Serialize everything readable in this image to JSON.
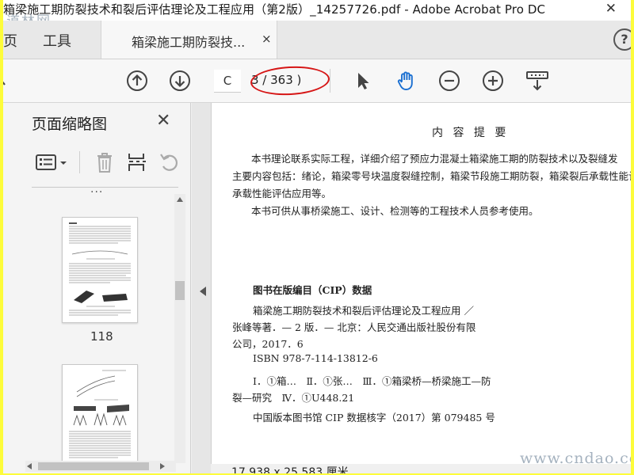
{
  "window": {
    "title": "箱梁施工期防裂技术和裂后评估理论及工程应用（第2版）_14257726.pdf - Adobe Acrobat Pro DC",
    "close_glyph": "✕",
    "watermark_top": "道林网"
  },
  "tabs": {
    "home": "页",
    "tools": "工具",
    "document": "箱梁施工期防裂技...",
    "close_glyph": "×",
    "help": "?"
  },
  "toolbar": {
    "page_input": "C",
    "page_count": "3 / 363 )",
    "icons": [
      "prev-page-icon",
      "next-page-icon",
      "select-arrow-icon",
      "hand-tool-icon",
      "zoom-out-icon",
      "zoom-in-icon",
      "scroll-mode-icon"
    ]
  },
  "panel": {
    "title": "页面缩略图",
    "close_glyph": "✕",
    "dots": "···",
    "thumbnail_page": "118"
  },
  "document": {
    "heading": "内 容 提 要",
    "p1_line1": "本书理论联系实际工程，详细介绍了预应力混凝土箱梁施工期的防裂技术以及裂缝发",
    "p1_line2": "主要内容包括：绪论，箱梁零号块温度裂缝控制，箱梁节段施工期防裂，箱梁裂后承载性能计",
    "p1_line3": "承载性能评估应用等。",
    "p2": "本书可供从事桥梁施工、设计、检测等的工程技术人员参考使用。",
    "cip_title": "图书在版编目（CIP）数据",
    "cip_line1": "箱梁施工期防裂技术和裂后评估理论及工程应用 ／",
    "cip_line2": "张峰等著．— 2 版．— 北京：人民交通出版社股份有限",
    "cip_line3": "公司，2017．6",
    "isbn": "ISBN  978-7-114-13812-6",
    "class_line1": "Ⅰ．①箱…　Ⅱ．①张…　Ⅲ．①箱梁桥—桥梁施工—防",
    "class_line2": "裂—研究　Ⅳ．①U448.21",
    "cip_number": "中国版本图书馆 CIP 数据核字（2017）第 079485 号"
  },
  "status": {
    "page_size": "17.938 x 25.583 厘米"
  },
  "watermark": "www.cndao.com"
}
